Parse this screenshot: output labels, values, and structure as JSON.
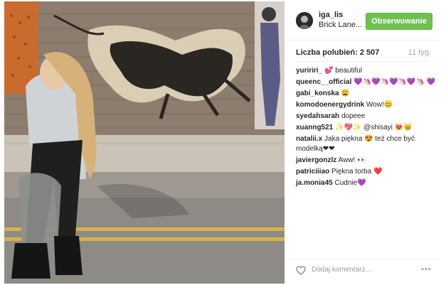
{
  "post": {
    "username": "iga_lis",
    "location": "Brick Lane...",
    "follow_label": "Obserwowanie",
    "likes": "Liczba polubień: 2 507",
    "time": "11 tyg."
  },
  "comments": [
    {
      "user": "yuririri_",
      "text": "💕 beautiful"
    },
    {
      "user": "queenc__official",
      "text": "💜🦄💜🦄💜🦄💜🦄 💜"
    },
    {
      "user": "gabi_konska",
      "text": "😩"
    },
    {
      "user": "komodoenergydrink",
      "text": "Wow!😊"
    },
    {
      "user": "syedahsarah",
      "text": "dopeee"
    },
    {
      "user": "xuanng521",
      "text": "✨💖✨ @shisayi 😻😸"
    },
    {
      "user": "natalii.x",
      "text": "Jaka piękna 😍 też chce być modelką❤❤"
    },
    {
      "user": "javiergonzlz",
      "text": "Aww! 👀"
    },
    {
      "user": "patriciiiao",
      "text": "Piękna torba ❤️"
    },
    {
      "user": "ja.monia45",
      "text": "Cudnie💜"
    }
  ],
  "footer": {
    "comment_placeholder": "Dodaj komentarz...",
    "more_label": "•••"
  }
}
